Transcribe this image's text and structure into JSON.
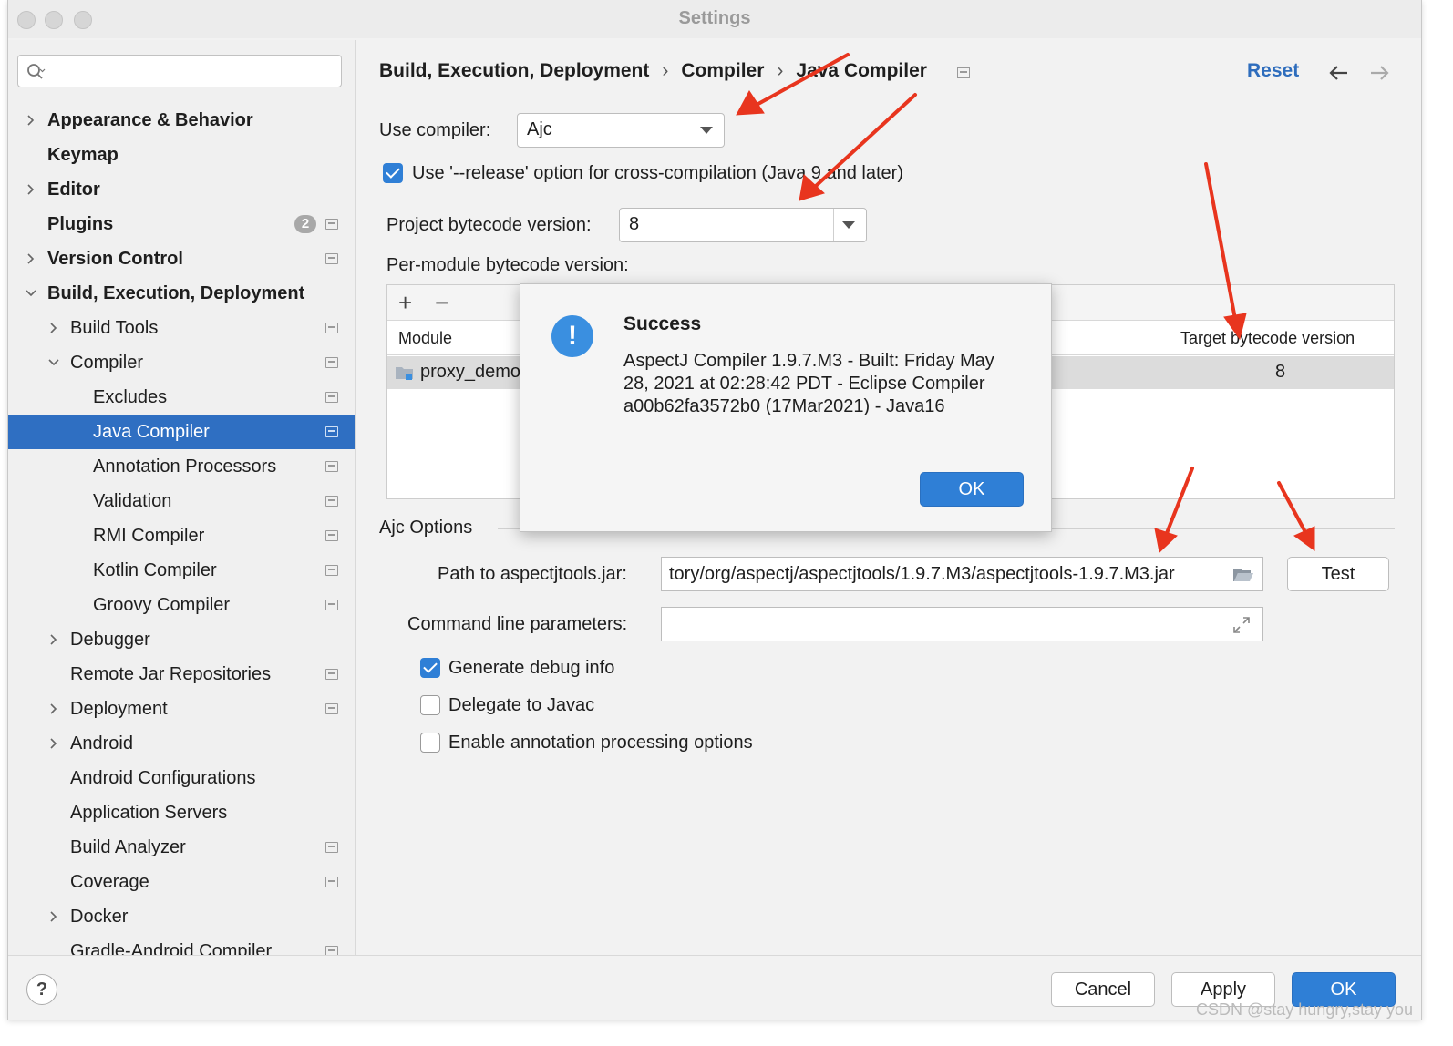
{
  "window": {
    "title": "Settings"
  },
  "sidebar": {
    "search_placeholder": "",
    "items": [
      {
        "label": "Appearance & Behavior"
      },
      {
        "label": "Keymap"
      },
      {
        "label": "Editor"
      },
      {
        "label": "Plugins",
        "badge": "2"
      },
      {
        "label": "Version Control"
      },
      {
        "label": "Build, Execution, Deployment"
      },
      {
        "label": "Build Tools"
      },
      {
        "label": "Compiler"
      },
      {
        "label": "Excludes"
      },
      {
        "label": "Java Compiler"
      },
      {
        "label": "Annotation Processors"
      },
      {
        "label": "Validation"
      },
      {
        "label": "RMI Compiler"
      },
      {
        "label": "Kotlin Compiler"
      },
      {
        "label": "Groovy Compiler"
      },
      {
        "label": "Debugger"
      },
      {
        "label": "Remote Jar Repositories"
      },
      {
        "label": "Deployment"
      },
      {
        "label": "Android"
      },
      {
        "label": "Android Configurations"
      },
      {
        "label": "Application Servers"
      },
      {
        "label": "Build Analyzer"
      },
      {
        "label": "Coverage"
      },
      {
        "label": "Docker"
      },
      {
        "label": "Gradle-Android Compiler"
      }
    ]
  },
  "header": {
    "breadcrumb": [
      "Build, Execution, Deployment",
      "Compiler",
      "Java Compiler"
    ],
    "separator": "›",
    "reset": "Reset"
  },
  "form": {
    "use_compiler_label": "Use compiler:",
    "use_compiler_value": "Ajc",
    "release_option_label": "Use '--release' option for cross-compilation (Java 9 and later)",
    "bytecode_label": "Project bytecode version:",
    "bytecode_value": "8",
    "per_module_label": "Per-module bytecode version:",
    "table": {
      "add": "+",
      "remove": "−",
      "col_module": "Module",
      "col_target": "Target bytecode version",
      "rows": [
        {
          "module": "proxy_demo",
          "target": "8"
        }
      ]
    },
    "ajc": {
      "title": "Ajc Options",
      "path_label": "Path to aspectjtools.jar:",
      "path_value": "tory/org/aspectj/aspectjtools/1.9.7.M3/aspectjtools-1.9.7.M3.jar",
      "test_button": "Test",
      "cmd_label": "Command line parameters:",
      "cmd_value": "",
      "gen_debug": "Generate debug info",
      "delegate": "Delegate to Javac",
      "annotation": "Enable annotation processing options"
    }
  },
  "dialog": {
    "icon_glyph": "!",
    "title": "Success",
    "message": "AspectJ Compiler 1.9.7.M3 - Built: Friday May 28, 2021 at 02:28:42 PDT - Eclipse Compiler a00b62fa3572b0 (17Mar2021) - Java16",
    "ok": "OK"
  },
  "footer": {
    "help": "?",
    "cancel": "Cancel",
    "apply": "Apply",
    "ok": "OK"
  },
  "watermark": "CSDN @stay hungry,stay you",
  "colors": {
    "accent": "#2f7fd6",
    "selection": "#2f6fc2",
    "link": "#2e6dbd",
    "annotation_arrow": "#e8351e"
  }
}
